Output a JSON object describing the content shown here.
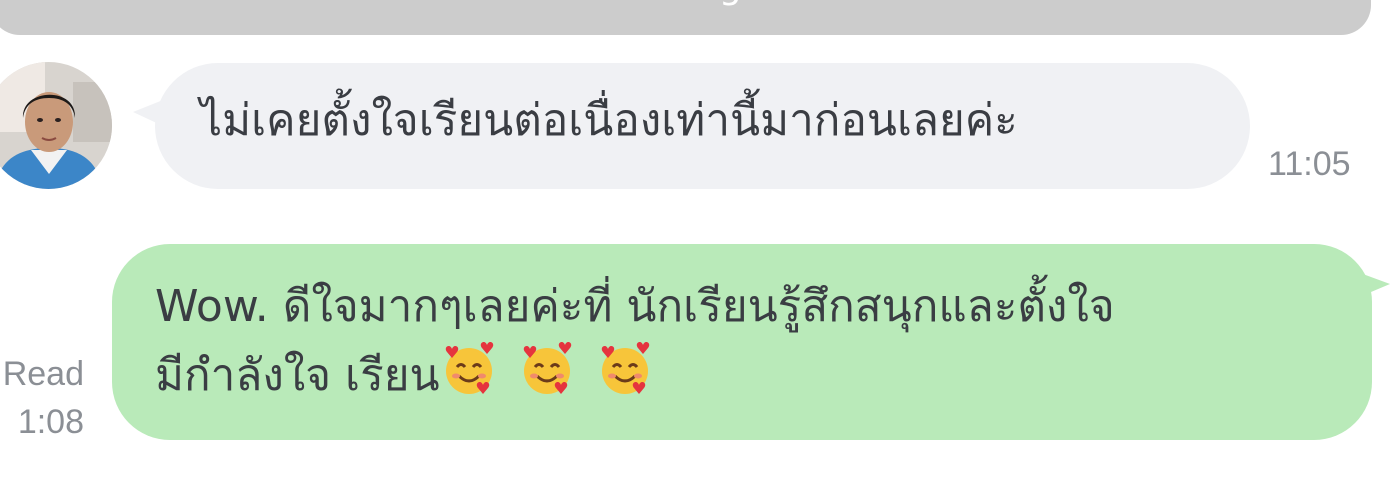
{
  "unread_banner": {
    "label": "Unread messages below"
  },
  "messages": [
    {
      "direction": "incoming",
      "text": "ไม่เคยตั้งใจเรียนต่อเนื่องเท่านี้มาก่อนเลยค่ะ",
      "time": "11:05",
      "bubble_color": "#f0f1f4"
    },
    {
      "direction": "outgoing",
      "line1": "Wow. ดีใจมากๆเลยค่ะที่ นักเรียนรู้สึกสนุกและตั้งใจ",
      "line2": "มีกำลังใจ เรียน",
      "emoji": [
        "smiling-face-with-hearts-icon",
        "smiling-face-with-hearts-icon",
        "smiling-face-with-hearts-icon"
      ],
      "read_label": "Read",
      "time": "1:08",
      "bubble_color": "#b9eab9"
    }
  ],
  "colors": {
    "banner": "#cccccc",
    "text": "#3a3d43",
    "meta_text": "#8b8f95"
  }
}
